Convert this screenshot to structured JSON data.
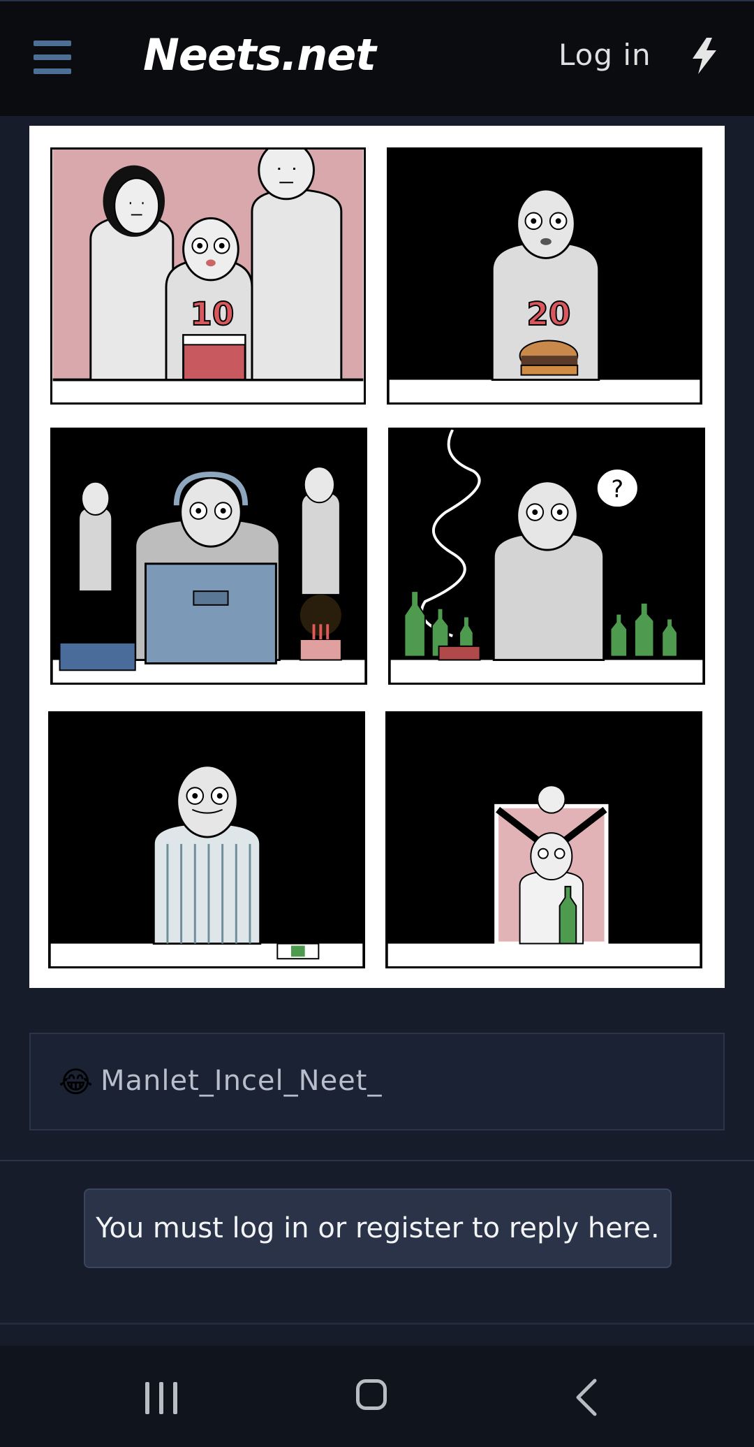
{
  "header": {
    "site_name": "Neets.net",
    "login_label": "Log in",
    "menu_icon": "hamburger-icon",
    "bolt_icon": "lightning-bolt-icon"
  },
  "comic": {
    "panel1_number": "10",
    "panel2_number": "20",
    "speech_bubble": "?"
  },
  "reaction": {
    "emoji": "😂",
    "username": "Manlet_Incel_Neet_"
  },
  "reply_notice": "You must log in or register to reply here.",
  "system_nav": {
    "recent_icon": "recent-apps-icon",
    "home_icon": "home-icon",
    "back_icon": "back-icon"
  },
  "colors": {
    "header_bg": "#0a0c10",
    "page_bg": "#161c2a",
    "menu_icon": "#4c6f93",
    "notice_bg": "#2a3348"
  }
}
